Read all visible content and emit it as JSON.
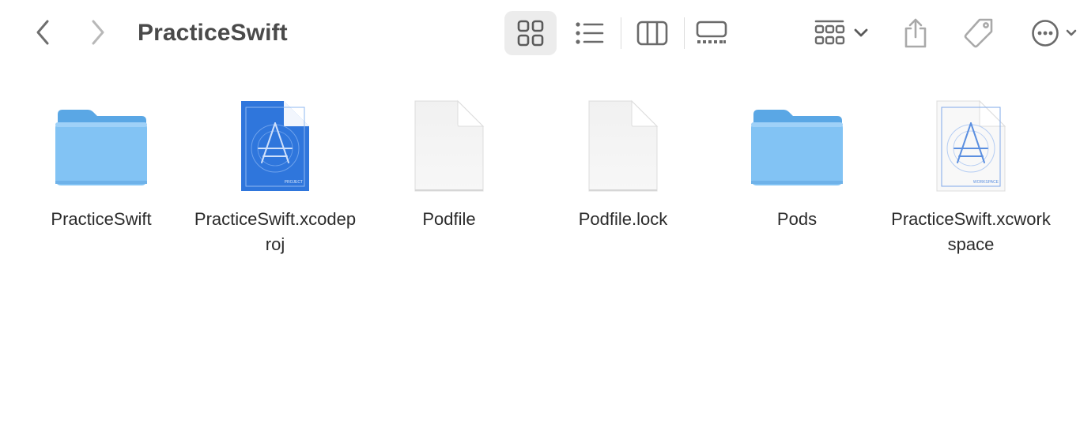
{
  "toolbar": {
    "title": "PracticeSwift",
    "back_icon": "chevron-left-icon",
    "forward_icon": "chevron-right-icon",
    "view_modes": [
      "icon-view",
      "list-view",
      "column-view",
      "gallery-view"
    ],
    "active_view": "icon-view",
    "group_icon": "group-icon",
    "share_icon": "share-icon",
    "tag_icon": "tag-icon",
    "more_icon": "more-icon"
  },
  "files": [
    {
      "name": "PracticeSwift",
      "kind": "folder-icon"
    },
    {
      "name": "PracticeSwift.xcodeproj",
      "kind": "xcodeproj-icon",
      "badge": "PROJECT"
    },
    {
      "name": "Podfile",
      "kind": "document-icon"
    },
    {
      "name": "Podfile.lock",
      "kind": "document-icon"
    },
    {
      "name": "Pods",
      "kind": "folder-icon"
    },
    {
      "name": "PracticeSwift.xcworkspace",
      "kind": "xcworkspace-icon",
      "badge": "WORKSPACE"
    }
  ],
  "colors": {
    "folder": "#7cc0f2",
    "folder_tab": "#5aa7e5",
    "project_blue": "#2f76dc",
    "icon_gray": "#6f6f6f",
    "active_view_bg": "#ececec"
  }
}
